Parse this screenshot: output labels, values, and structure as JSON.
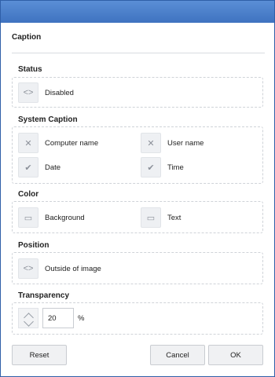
{
  "caption": "Caption",
  "sections": {
    "status": {
      "title": "Status",
      "items": [
        {
          "label": "Disabled",
          "icon": "code-brackets-icon"
        }
      ]
    },
    "system_caption": {
      "title": "System Caption",
      "items": [
        {
          "label": "Computer name",
          "icon": "x-icon"
        },
        {
          "label": "User name",
          "icon": "x-icon"
        },
        {
          "label": "Date",
          "icon": "check-icon"
        },
        {
          "label": "Time",
          "icon": "check-icon"
        }
      ]
    },
    "color": {
      "title": "Color",
      "items": [
        {
          "label": "Background",
          "icon": "window-icon"
        },
        {
          "label": "Text",
          "icon": "window-icon"
        }
      ]
    },
    "position": {
      "title": "Position",
      "items": [
        {
          "label": "Outside of image",
          "icon": "code-brackets-icon"
        }
      ]
    },
    "transparency": {
      "title": "Transparency",
      "value": "20",
      "unit": "%"
    }
  },
  "buttons": {
    "reset": "Reset",
    "cancel": "Cancel",
    "ok": "OK"
  }
}
